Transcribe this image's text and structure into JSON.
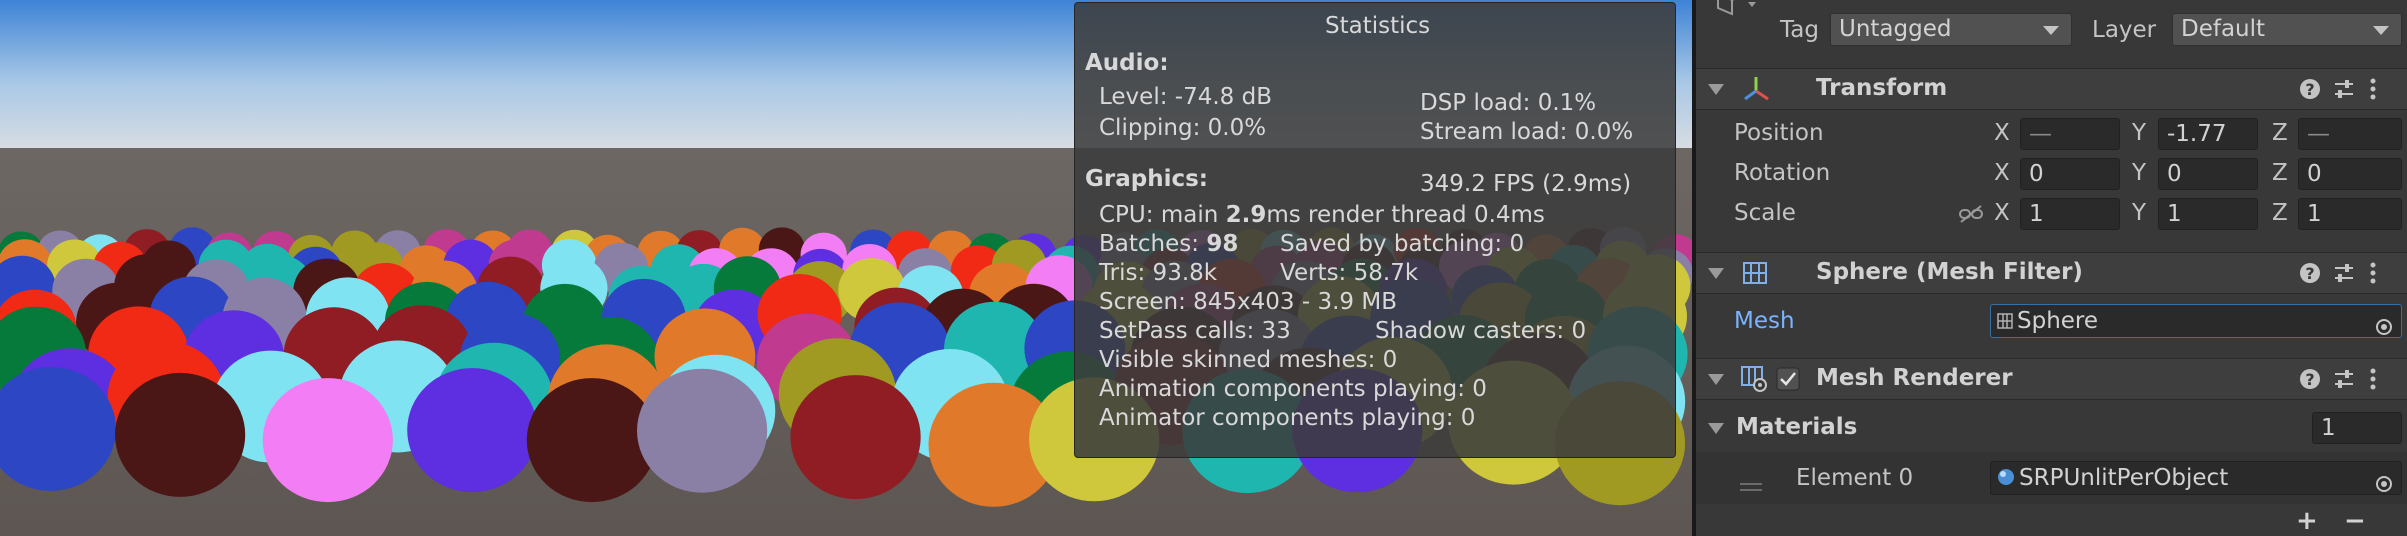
{
  "statistics": {
    "title": "Statistics",
    "audio_header": "Audio:",
    "level": "Level: -74.8 dB",
    "dsp_load": "DSP load: 0.1%",
    "clipping": "Clipping: 0.0%",
    "stream_load": "Stream load: 0.0%",
    "graphics_header": "Graphics:",
    "fps": "349.2 FPS (2.9ms)",
    "cpu_prefix": "CPU: main ",
    "cpu_main": "2.9",
    "cpu_suffix": "ms  render thread 0.4ms",
    "batches_prefix": "Batches: ",
    "batches_value": "98",
    "saved_by_batching": "Saved by batching: 0",
    "tris": "Tris: 93.8k",
    "verts": "Verts: 58.7k",
    "screen": "Screen: 845x403 - 3.9 MB",
    "setpass": "SetPass calls: 33",
    "shadow_casters": "Shadow casters: 0",
    "visible_skinned": "Visible skinned meshes: 0",
    "animation_components": "Animation components playing: 0",
    "animator_components": "Animator components playing: 0"
  },
  "inspector": {
    "tag_label": "Tag",
    "tag_value": "Untagged",
    "layer_label": "Layer",
    "layer_value": "Default",
    "transform": {
      "title": "Transform",
      "position_label": "Position",
      "position": {
        "x": "—",
        "y": "-1.77",
        "z": "—"
      },
      "rotation_label": "Rotation",
      "rotation": {
        "x": "0",
        "y": "0",
        "z": "0"
      },
      "scale_label": "Scale",
      "scale": {
        "x": "1",
        "y": "1",
        "z": "1"
      },
      "axis_x": "X",
      "axis_y": "Y",
      "axis_z": "Z"
    },
    "mesh_filter": {
      "title": "Sphere (Mesh Filter)",
      "mesh_label": "Mesh",
      "mesh_value": "Sphere"
    },
    "mesh_renderer": {
      "title": "Mesh Renderer",
      "enabled": true,
      "materials_label": "Materials",
      "materials_count": "1",
      "element0_label": "Element 0",
      "element0_value": "SRPUnlitPerObject"
    },
    "add_label": "+",
    "remove_label": "−",
    "colors": {
      "accent_link": "#7ab4ff",
      "panel": "#383838",
      "header": "#3e3e3e"
    }
  }
}
